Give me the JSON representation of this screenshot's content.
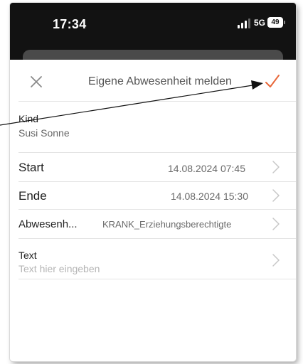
{
  "status_bar": {
    "time": "17:34",
    "network": "5G",
    "battery": "49"
  },
  "nav": {
    "title": "Eigene Abwesenheit melden",
    "close_icon": "close-icon",
    "confirm_icon": "checkmark-icon",
    "accent_color": "#e8683a"
  },
  "form": {
    "kind": {
      "label": "Kind",
      "value": "Susi Sonne"
    },
    "start": {
      "label": "Start",
      "value": "14.08.2024 07:45"
    },
    "ende": {
      "label": "Ende",
      "value": "14.08.2024 15:30"
    },
    "abwesenheit": {
      "label": "Abwesenh...",
      "value": "KRANK_Erziehungsberechtigte"
    },
    "text": {
      "label": "Text",
      "placeholder": "Text hier eingeben"
    }
  }
}
